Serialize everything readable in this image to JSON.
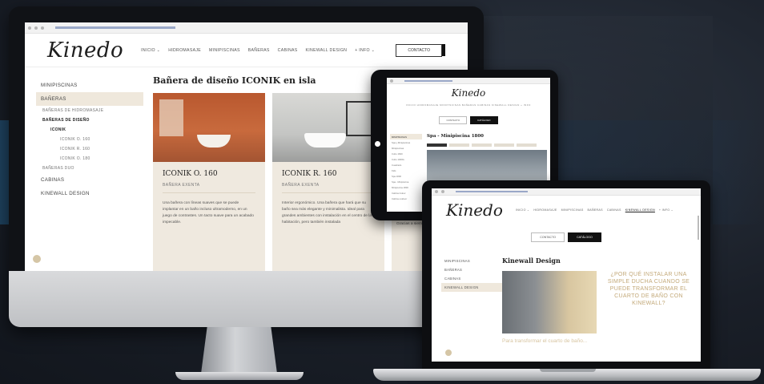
{
  "desktop": {
    "logo": "Kinedo",
    "nav": [
      "INICIO ⌄",
      "HIDROMASAJE",
      "MINIPISCINAS",
      "BAÑERAS",
      "CABINAS",
      "KINEWALL DESIGN",
      "+ INFO ⌄"
    ],
    "contact_label": "CONTACTO",
    "sidebar": {
      "minipiscinas": "MINIPISCINAS",
      "baneras": "BAÑERAS",
      "banera_hidromasaje": "BAÑERAS DE HIDROMASAJE",
      "baneras_diseno": "BAÑERAS DE DISEÑO",
      "iconik": "ICONIK",
      "iconik_o": "ICONIK O. 160",
      "iconik_r": "ICONIK R. 160",
      "iconik_o2": "ICONIK O. 180",
      "baneras_duo": "BAÑERAS DUO",
      "cabinas": "CABINAS",
      "kinewall": "KINEWALL DESIGN"
    },
    "main_title": "Bañera de diseño ICONIK en isla",
    "cards": [
      {
        "title": "ICONIK O. 160",
        "subtitle": "BAÑERA EXENTA",
        "text": "Una bañera con líneas suaves que se puede implantar en un baño incluso ultramoderno, en un juego de contrastes. Un tacto suave para un acabado impecable."
      },
      {
        "title": "ICONIK R. 160",
        "subtitle": "BAÑERA EXENTA",
        "text": "Interior ergonómico. Una bañera que hará que su baño sea más elegante y minimalista. Ideal para grandes ambientes con instalación en el centro de la habitación, pero también instalada"
      }
    ],
    "card_edge_text": "Gracias a siempre modern"
  },
  "tablet": {
    "logo": "Kinedo",
    "nav": "INICIO  HIDROMASAJE  MINIPISCINAS  BAÑERAS  CABINAS  KINEWALL DESIGN  + INFO",
    "btn_contact": "CONTACTO",
    "btn_catalog": "CATÁLOGO",
    "side_items": [
      "MINIPISCINAS",
      "Spa y Minipiscinas",
      "Minipiscinas",
      "Cubo 1600",
      "Cubo 1000G",
      "Cuadrado",
      "Kids",
      "Spa 1800",
      "Spa - Minipiscina",
      "Minipiscina 1800",
      "Cabina Indoor",
      "Cabina outdoor"
    ],
    "title": "Spa - Minipiscina 1800"
  },
  "laptop": {
    "logo": "Kinedo",
    "nav": [
      "INICIO ⌄",
      "HIDROMASAJE",
      "MINIPISCINAS",
      "BAÑERAS",
      "CABINAS",
      "KINEWALL DESIGN",
      "+ INFO ⌄"
    ],
    "btn_contact": "CONTACTO",
    "btn_catalog": "CATÁLOGO",
    "sidebar": [
      "MINIPISCINAS",
      "BAÑERAS",
      "CABINAS",
      "KINEWALL DESIGN"
    ],
    "title": "Kinewall Design",
    "quote": "¿POR QUÉ INSTALAR UNA SIMPLE DUCHA CUANDO SE PUEDE TRANSFORMAR EL CUARTO DE BAÑO CON KINEWALL?",
    "footer": "Para transformar el cuarto de baño..."
  }
}
